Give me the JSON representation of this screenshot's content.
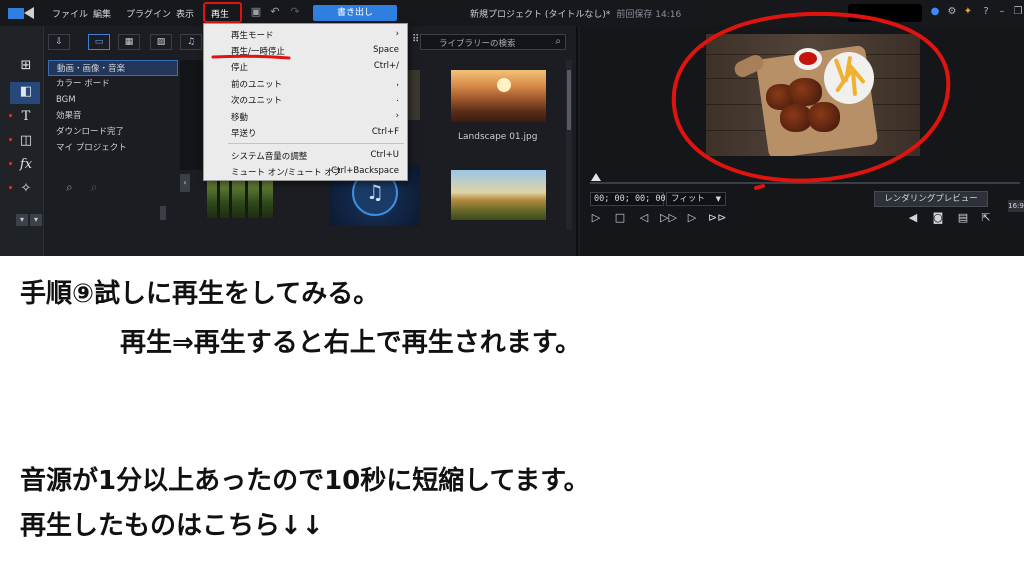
{
  "menu": {
    "items": [
      "ファイル",
      "編集",
      "プラグイン",
      "表示",
      "再生"
    ],
    "export_label": "書き出し"
  },
  "window": {
    "title": "新規プロジェクト (タイトルなし)*",
    "saved": "前回保存 14:16"
  },
  "library": {
    "search_placeholder": "ライブラリーの検索",
    "categories": [
      "動画・画像・音楽",
      "カラー ボード",
      "BGM",
      "効果音",
      "ダウンロード完了",
      "マイ プロジェクト"
    ],
    "thumb_label": "Landscape 01.jpg"
  },
  "dropdown": {
    "items": [
      {
        "label": "再生モード",
        "key": "›"
      },
      {
        "label": "再生/一時停止",
        "key": "Space"
      },
      {
        "label": "停止",
        "key": "Ctrl+/"
      },
      {
        "label": "前のユニット",
        "key": ","
      },
      {
        "label": "次のユニット",
        "key": "."
      },
      {
        "label": "移動",
        "key": "›"
      },
      {
        "label": "早送り",
        "key": "Ctrl+F"
      },
      {
        "label": "システム音量の調整",
        "key": "Ctrl+U"
      },
      {
        "label": "ミュート オン/ミュート オフ",
        "key": "Ctrl+Backspace"
      }
    ]
  },
  "preview": {
    "timecode": "00; 00; 00; 00",
    "fit": "フィット",
    "render_label": "レンダリングプレビュー",
    "resolution": "16:9"
  },
  "annotations": {
    "line1": "手順⑨試しに再生をしてみる。",
    "line2": "再生⇒再生すると右上で再生されます。",
    "line3": "音源が1分以上あったので10秒に短縮してます。",
    "line4": "再生したものはこちら↓↓"
  },
  "colors": {
    "accent": "#2f7fe0",
    "highlight": "#e0140f"
  }
}
